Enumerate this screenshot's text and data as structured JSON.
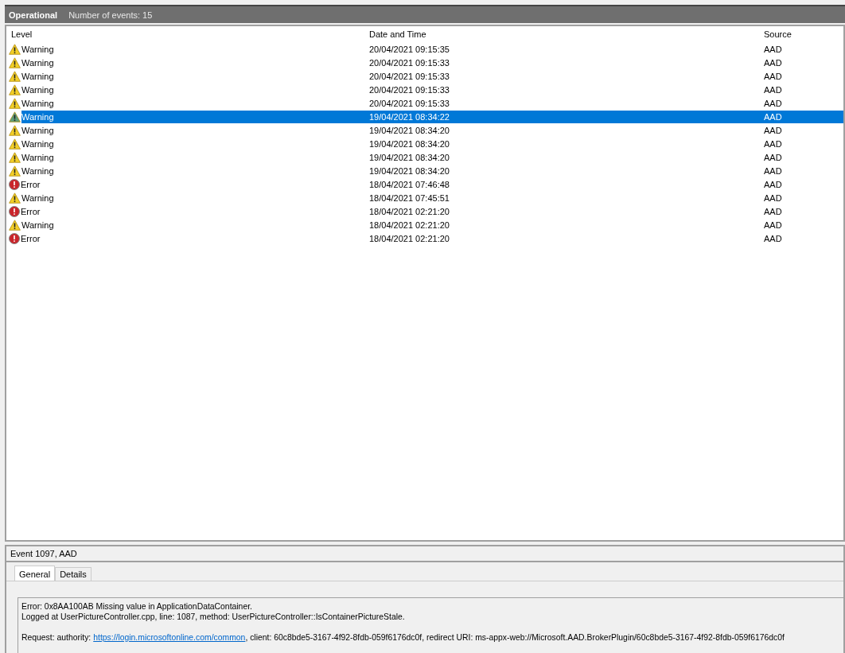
{
  "header": {
    "title": "Operational",
    "count": "Number of events: 15"
  },
  "table": {
    "columns": [
      "Level",
      "Date and Time",
      "Source"
    ],
    "rows": [
      {
        "kind": "warning",
        "level": "Warning",
        "date": "20/04/2021 09:15:35",
        "source": "AAD",
        "selected": false
      },
      {
        "kind": "warning",
        "level": "Warning",
        "date": "20/04/2021 09:15:33",
        "source": "AAD",
        "selected": false
      },
      {
        "kind": "warning",
        "level": "Warning",
        "date": "20/04/2021 09:15:33",
        "source": "AAD",
        "selected": false
      },
      {
        "kind": "warning",
        "level": "Warning",
        "date": "20/04/2021 09:15:33",
        "source": "AAD",
        "selected": false
      },
      {
        "kind": "warning",
        "level": "Warning",
        "date": "20/04/2021 09:15:33",
        "source": "AAD",
        "selected": false
      },
      {
        "kind": "warning",
        "level": "Warning",
        "date": "19/04/2021 08:34:22",
        "source": "AAD",
        "selected": true
      },
      {
        "kind": "warning",
        "level": "Warning",
        "date": "19/04/2021 08:34:20",
        "source": "AAD",
        "selected": false
      },
      {
        "kind": "warning",
        "level": "Warning",
        "date": "19/04/2021 08:34:20",
        "source": "AAD",
        "selected": false
      },
      {
        "kind": "warning",
        "level": "Warning",
        "date": "19/04/2021 08:34:20",
        "source": "AAD",
        "selected": false
      },
      {
        "kind": "warning",
        "level": "Warning",
        "date": "19/04/2021 08:34:20",
        "source": "AAD",
        "selected": false
      },
      {
        "kind": "error",
        "level": "Error",
        "date": "18/04/2021 07:46:48",
        "source": "AAD",
        "selected": false
      },
      {
        "kind": "warning",
        "level": "Warning",
        "date": "18/04/2021 07:45:51",
        "source": "AAD",
        "selected": false
      },
      {
        "kind": "error",
        "level": "Error",
        "date": "18/04/2021 02:21:20",
        "source": "AAD",
        "selected": false
      },
      {
        "kind": "warning",
        "level": "Warning",
        "date": "18/04/2021 02:21:20",
        "source": "AAD",
        "selected": false
      },
      {
        "kind": "error",
        "level": "Error",
        "date": "18/04/2021 02:21:20",
        "source": "AAD",
        "selected": false
      }
    ]
  },
  "details": {
    "title": "Event 1097, AAD",
    "tabs": [
      {
        "label": "General",
        "selected": true
      },
      {
        "label": "Details",
        "selected": false
      }
    ],
    "lines": [
      "Error: 0x8AA100AB Missing value in ApplicationDataContainer.",
      "Logged at UserPictureController.cpp, line: 1087, method: UserPictureController::IsContainerPictureStale."
    ],
    "request": {
      "prefix": "Request: authority:",
      "link": "https://login.microsoftonline.com/common",
      "suffix": ", client: 60c8bde5-3167-4f92-8fdb-059f6176dc0f, redirect URI: ms-appx-web://Microsoft.AAD.BrokerPlugin/60c8bde5-3167-4f92-8fdb-059f6176dc0f"
    }
  }
}
